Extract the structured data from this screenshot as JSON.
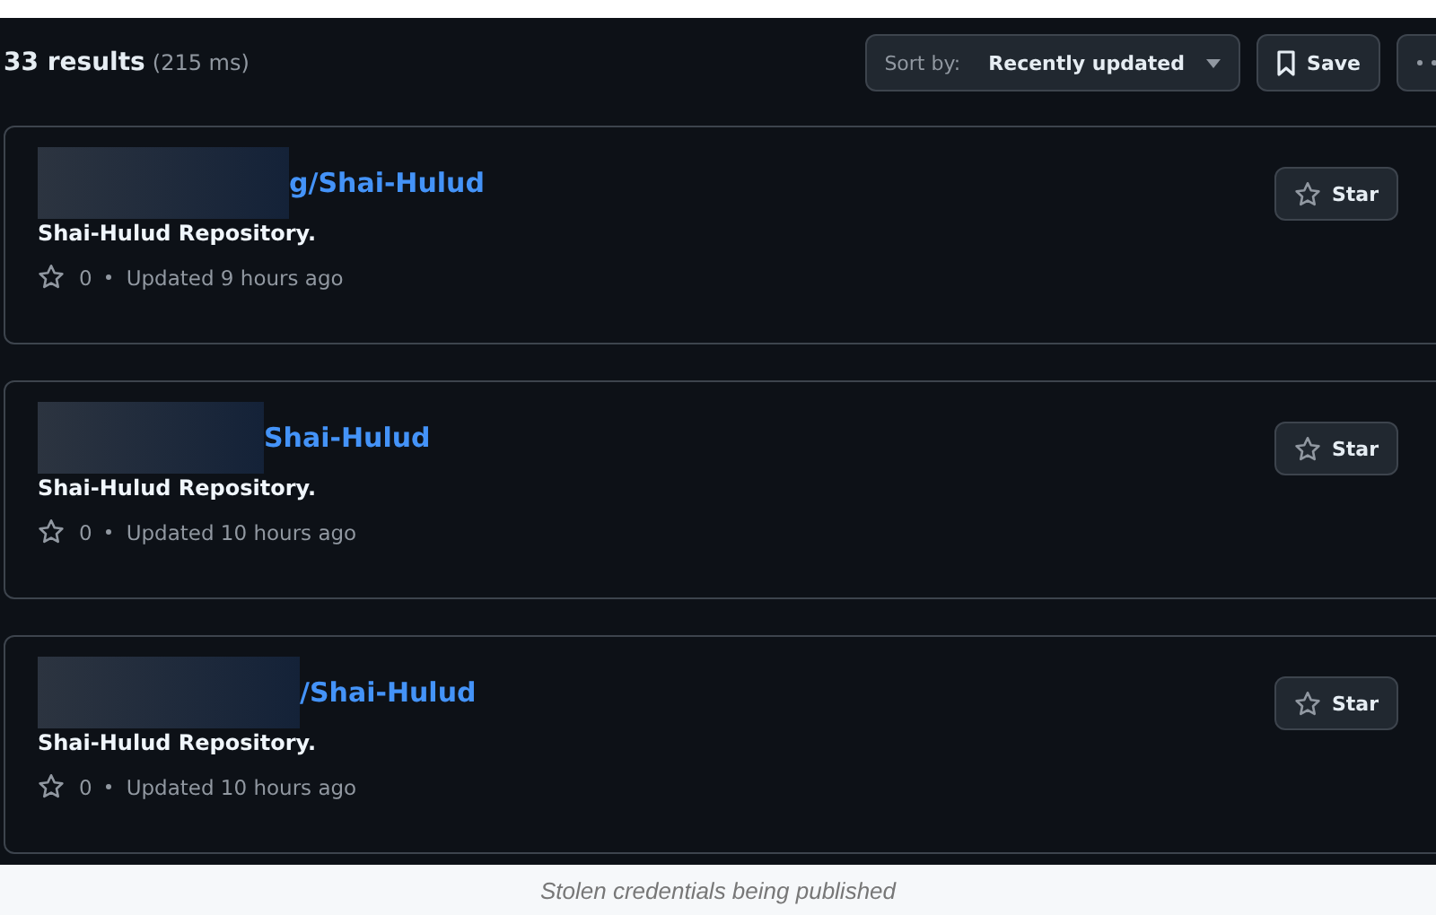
{
  "header": {
    "count": "33 results",
    "timing": "(215 ms)",
    "sort_label": "Sort by:",
    "sort_value": "Recently updated",
    "save": "Save"
  },
  "results": [
    {
      "name": "g/Shai-Hulud",
      "description": "Shai-Hulud Repository.",
      "stars": "0",
      "updated": "Updated 9 hours ago",
      "star_button": "Star"
    },
    {
      "name": "Shai-Hulud",
      "description": "Shai-Hulud Repository.",
      "stars": "0",
      "updated": "Updated 10 hours ago",
      "star_button": "Star"
    },
    {
      "name": "/Shai-Hulud",
      "description": "Shai-Hulud Repository.",
      "stars": "0",
      "updated": "Updated 10 hours ago",
      "star_button": "Star"
    }
  ],
  "caption": "Stolen credentials being published"
}
